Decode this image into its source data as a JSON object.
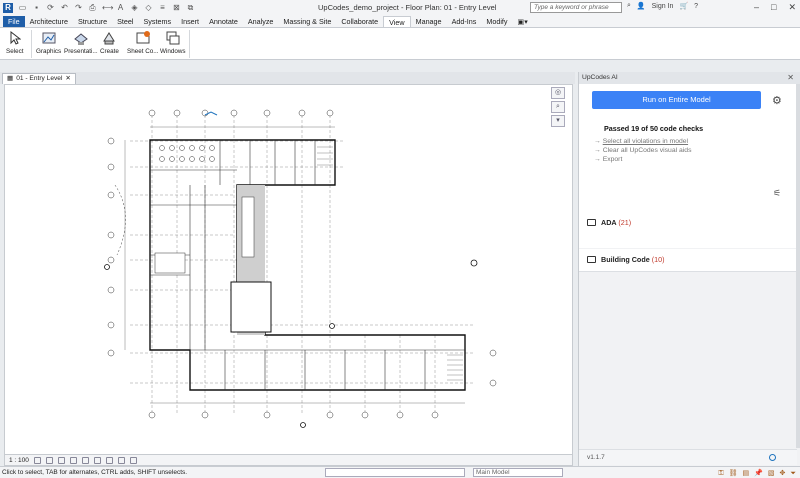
{
  "window": {
    "title": "UpCodes_demo_project - Floor Plan: 01 - Entry Level",
    "search_placeholder": "Type a keyword or phrase",
    "sign_in": "Sign In"
  },
  "ribbon": {
    "tabs": [
      "File",
      "Architecture",
      "Structure",
      "Steel",
      "Systems",
      "Insert",
      "Annotate",
      "Analyze",
      "Massing & Site",
      "Collaborate",
      "View",
      "Manage",
      "Add-Ins",
      "Modify"
    ],
    "active_tab": "View",
    "buttons": {
      "select": "Select",
      "graphics": "Graphics",
      "presentation": "Presentati...",
      "create": "Create",
      "sheet": "Sheet Co...",
      "windows": "Windows"
    }
  },
  "view": {
    "tab_label": "01 - Entry Level",
    "scale": "1 : 100"
  },
  "status": {
    "message": "Click to select, TAB for alternates, CTRL adds, SHIFT unselects.",
    "workset_value": "",
    "model": "Main Model"
  },
  "panel": {
    "title": "UpCodes AI",
    "run_button": "Run on Entire Model",
    "passed_text": "Passed 19 of 50 code checks",
    "links": [
      "Select all violations in model",
      "Clear all UpCodes visual aids",
      "Export"
    ],
    "groups": [
      {
        "name": "ADA",
        "count": "(21)"
      },
      {
        "name": "Building Code",
        "count": "(10)"
      }
    ],
    "version": "v1.1.7"
  },
  "colors": {
    "accent": "#3b82f6",
    "file_tab": "#1f5ea8",
    "violation_count": "#c0392b"
  }
}
